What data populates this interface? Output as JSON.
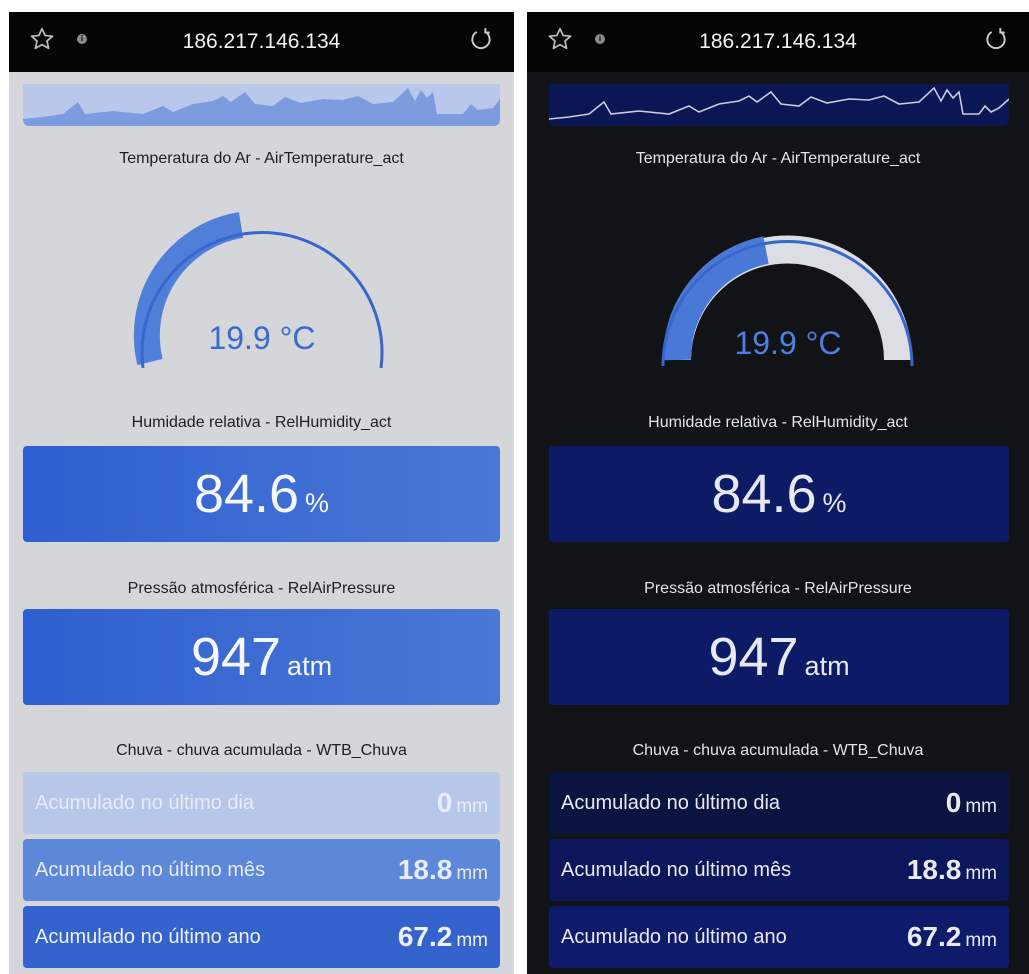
{
  "browser": {
    "address": "186.217.146.134"
  },
  "temperature": {
    "title": "Temperatura do Ar - AirTemperature_act",
    "display": "19.9 °C",
    "gauge_fraction": 0.38
  },
  "humidity": {
    "title": "Humidade relativa - RelHumidity_act",
    "value": "84.6",
    "unit": "%"
  },
  "pressure": {
    "title": "Pressão atmosférica - RelAirPressure",
    "value": "947",
    "unit": "atm"
  },
  "rain": {
    "title": "Chuva - chuva acumulada - WTB_Chuva",
    "rows": [
      {
        "label": "Acumulado no último dia",
        "value": "0",
        "unit": "mm"
      },
      {
        "label": "Acumulado no último mês",
        "value": "18.8",
        "unit": "mm"
      },
      {
        "label": "Acumulado no último ano",
        "value": "67.2",
        "unit": "mm"
      }
    ]
  },
  "icons": [
    "star-icon",
    "info-icon",
    "reload-icon"
  ],
  "colors": {
    "light_accent": "#3463cd",
    "dark_accent": "#0d1a66",
    "gauge_fill": "#4a78d6"
  }
}
